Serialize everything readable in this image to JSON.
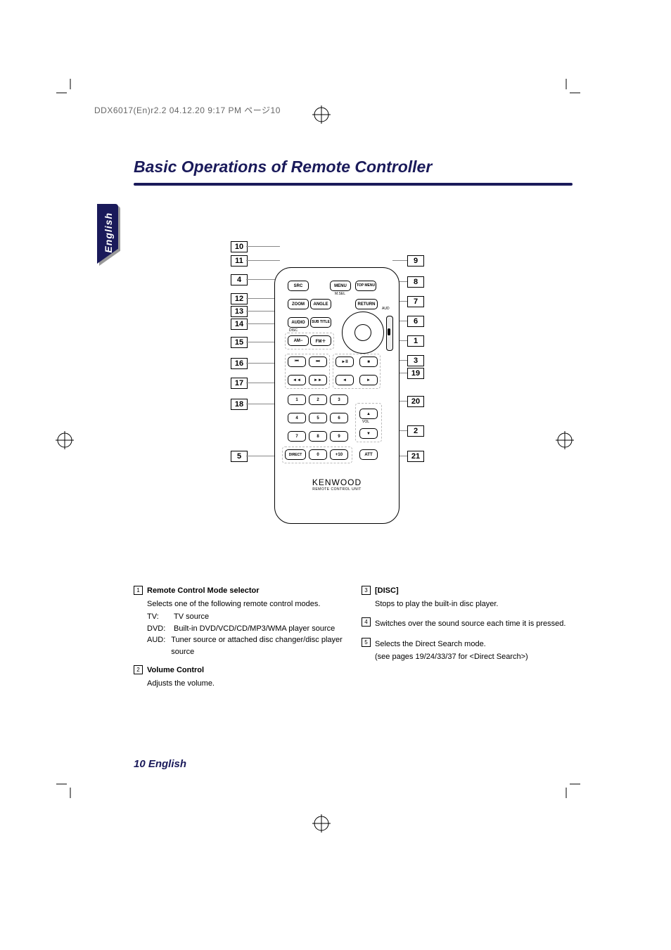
{
  "header_line": "DDX6017(En)r2.2  04.12.20  9:17 PM  ページ10",
  "page_title": "Basic Operations of Remote Controller",
  "language_tab": "English",
  "footer": "10 English",
  "remote": {
    "brand": "KENWOOD",
    "brand_sub": "REMOTE CONTROL UNIT",
    "labels": {
      "src": "SRC",
      "menu": "MENU",
      "topmenu": "TOP\nMENU",
      "zoom": "ZOOM",
      "angle": "ANGLE",
      "return": "RETURN",
      "audio": "AUDIO",
      "subtitle": "SUB\nTITLE",
      "am": "AM−",
      "fm": "FM＋",
      "prev": "⏮",
      "next": "⏭",
      "play": "►II",
      "stop": "■",
      "rew": "◄◄",
      "ffwd": "►►",
      "left": "◄",
      "right": "►",
      "1": "1",
      "2": "2",
      "3": "3",
      "4": "4",
      "5": "5",
      "6": "6",
      "7": "7",
      "8": "8",
      "9": "9",
      "0": "0",
      "direct": "DIRECT",
      "plus10": "+10",
      "att": "ATT",
      "up": "▲",
      "down": "▼",
      "vol": "VOL",
      "msel": "M.SEL",
      "aud": "AUD",
      "disc": "DISC"
    }
  },
  "callouts_left": [
    "10",
    "11",
    "4",
    "12",
    "13",
    "14",
    "15",
    "16",
    "17",
    "18",
    "5"
  ],
  "callouts_right": [
    "9",
    "8",
    "7",
    "6",
    "1",
    "3",
    "19",
    "20",
    "2",
    "21"
  ],
  "descriptions": {
    "left": [
      {
        "num": "1",
        "title": "Remote Control Mode selector",
        "text": "Selects one of the following remote control modes.",
        "list": [
          {
            "k": "TV:",
            "v": "TV source"
          },
          {
            "k": "DVD:",
            "v": "Built-in DVD/VCD/CD/MP3/WMA player source"
          },
          {
            "k": "AUD:",
            "v": "Tuner source or attached disc changer/disc player source"
          }
        ]
      },
      {
        "num": "2",
        "title": "Volume Control",
        "text": "Adjusts the volume."
      }
    ],
    "right": [
      {
        "num": "3",
        "title": "[DISC]",
        "text": "Stops to play the built-in disc player."
      },
      {
        "num": "4",
        "text": "Switches over the sound source each time it is pressed."
      },
      {
        "num": "5",
        "text": "Selects the Direct Search mode.",
        "note": "(see pages 19/24/33/37 for <Direct Search>)"
      }
    ]
  }
}
